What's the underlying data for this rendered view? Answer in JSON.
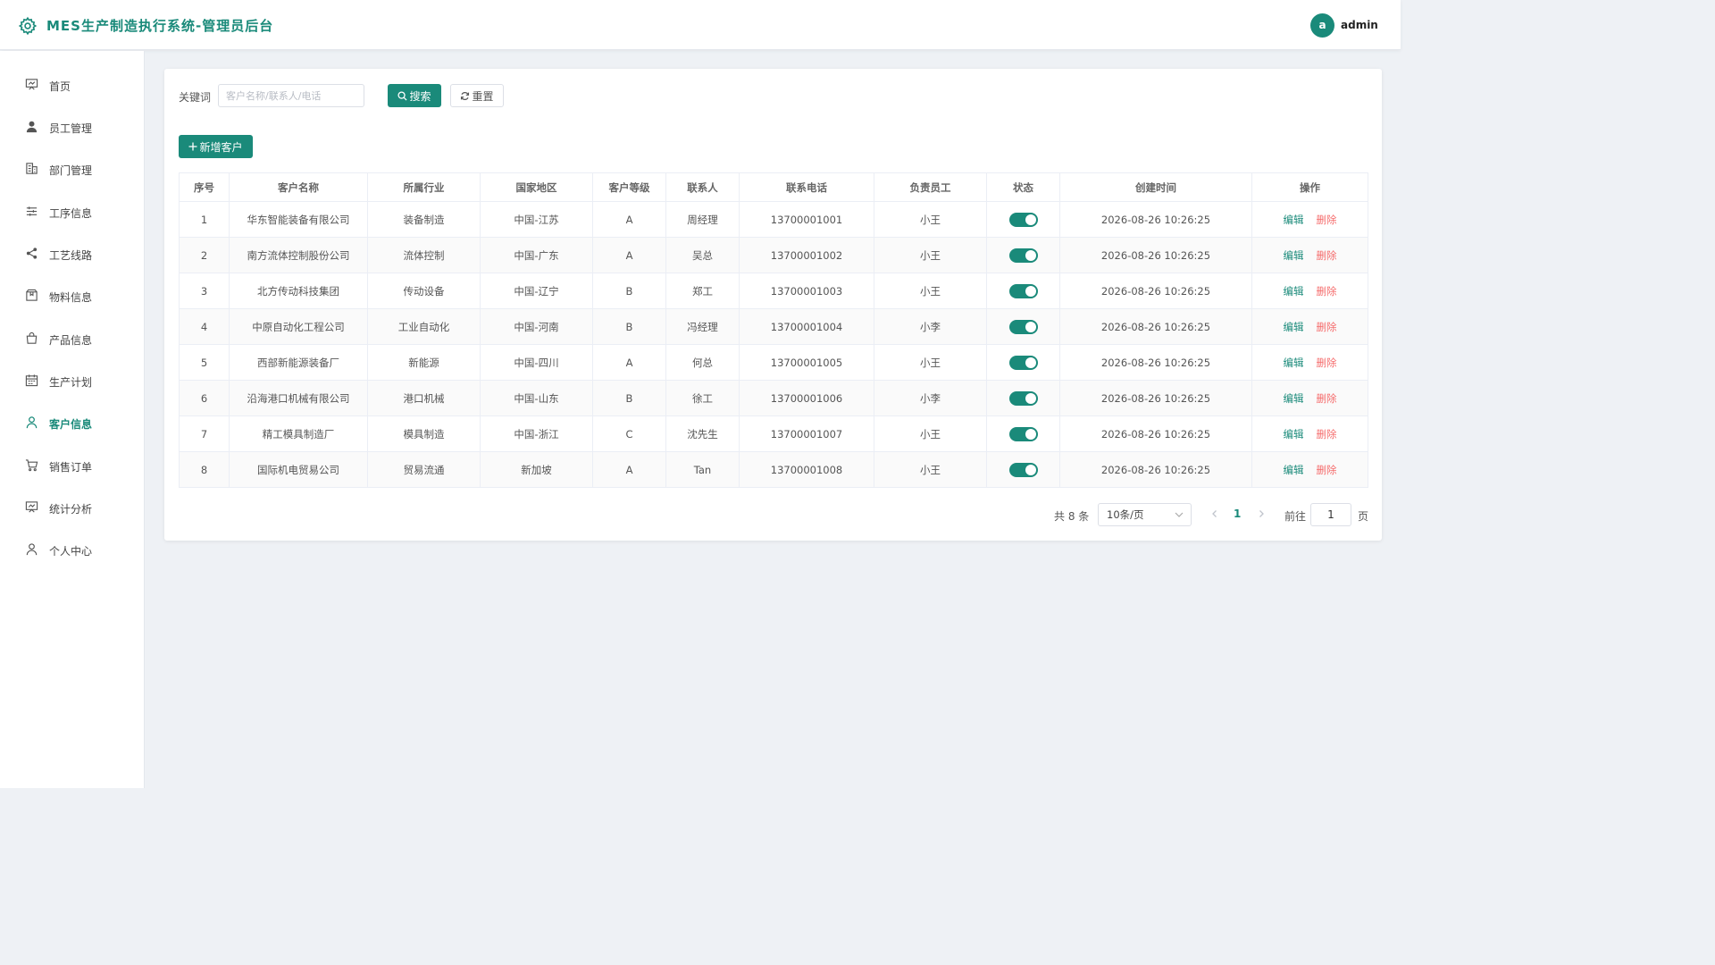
{
  "app": {
    "title": "MES生产制造执行系统-管理员后台"
  },
  "user": {
    "avatar_letter": "a",
    "name": "admin"
  },
  "sidebar": {
    "items": [
      {
        "label": "首页",
        "icon": "dashboard-icon"
      },
      {
        "label": "员工管理",
        "icon": "user-icon"
      },
      {
        "label": "部门管理",
        "icon": "building-icon"
      },
      {
        "label": "工序信息",
        "icon": "sliders-icon"
      },
      {
        "label": "工艺线路",
        "icon": "share-icon"
      },
      {
        "label": "物料信息",
        "icon": "box-icon"
      },
      {
        "label": "产品信息",
        "icon": "bag-icon"
      },
      {
        "label": "生产计划",
        "icon": "calendar-icon"
      },
      {
        "label": "客户信息",
        "icon": "user-outline-icon",
        "active": true
      },
      {
        "label": "销售订单",
        "icon": "cart-icon"
      },
      {
        "label": "统计分析",
        "icon": "chart-board-icon"
      },
      {
        "label": "个人中心",
        "icon": "person-icon"
      }
    ]
  },
  "search": {
    "keyword_label": "关键词",
    "placeholder": "客户名称/联系人/电话",
    "value": "",
    "search_label": "搜索",
    "reset_label": "重置"
  },
  "toolbar": {
    "add_label": "新增客户"
  },
  "table": {
    "columns": [
      "序号",
      "客户名称",
      "所属行业",
      "国家地区",
      "客户等级",
      "联系人",
      "联系电话",
      "负责员工",
      "状态",
      "创建时间",
      "操作"
    ],
    "edit_label": "编辑",
    "delete_label": "删除",
    "rows": [
      {
        "no": "1",
        "name": "华东智能装备有限公司",
        "industry": "装备制造",
        "region": "中国-江苏",
        "level": "A",
        "contact": "周经理",
        "phone": "13700001001",
        "staff": "小王",
        "enabled": true,
        "created": "2026-08-26 10:26:25"
      },
      {
        "no": "2",
        "name": "南方流体控制股份公司",
        "industry": "流体控制",
        "region": "中国-广东",
        "level": "A",
        "contact": "吴总",
        "phone": "13700001002",
        "staff": "小王",
        "enabled": true,
        "created": "2026-08-26 10:26:25"
      },
      {
        "no": "3",
        "name": "北方传动科技集团",
        "industry": "传动设备",
        "region": "中国-辽宁",
        "level": "B",
        "contact": "郑工",
        "phone": "13700001003",
        "staff": "小王",
        "enabled": true,
        "created": "2026-08-26 10:26:25"
      },
      {
        "no": "4",
        "name": "中原自动化工程公司",
        "industry": "工业自动化",
        "region": "中国-河南",
        "level": "B",
        "contact": "冯经理",
        "phone": "13700001004",
        "staff": "小李",
        "enabled": true,
        "created": "2026-08-26 10:26:25"
      },
      {
        "no": "5",
        "name": "西部新能源装备厂",
        "industry": "新能源",
        "region": "中国-四川",
        "level": "A",
        "contact": "何总",
        "phone": "13700001005",
        "staff": "小王",
        "enabled": true,
        "created": "2026-08-26 10:26:25"
      },
      {
        "no": "6",
        "name": "沿海港口机械有限公司",
        "industry": "港口机械",
        "region": "中国-山东",
        "level": "B",
        "contact": "徐工",
        "phone": "13700001006",
        "staff": "小李",
        "enabled": true,
        "created": "2026-08-26 10:26:25"
      },
      {
        "no": "7",
        "name": "精工模具制造厂",
        "industry": "模具制造",
        "region": "中国-浙江",
        "level": "C",
        "contact": "沈先生",
        "phone": "13700001007",
        "staff": "小王",
        "enabled": true,
        "created": "2026-08-26 10:26:25"
      },
      {
        "no": "8",
        "name": "国际机电贸易公司",
        "industry": "贸易流通",
        "region": "新加坡",
        "level": "A",
        "contact": "Tan",
        "phone": "13700001008",
        "staff": "小王",
        "enabled": true,
        "created": "2026-08-26 10:26:25"
      }
    ]
  },
  "pagination": {
    "total_text": "共 8 条",
    "page_size": "10条/页",
    "current_page": "1",
    "goto_label": "前往",
    "goto_value": "1",
    "page_suffix": "页"
  },
  "colors": {
    "primary": "#1a8a7a",
    "danger": "#f56c6c",
    "background": "#eef1f5"
  }
}
